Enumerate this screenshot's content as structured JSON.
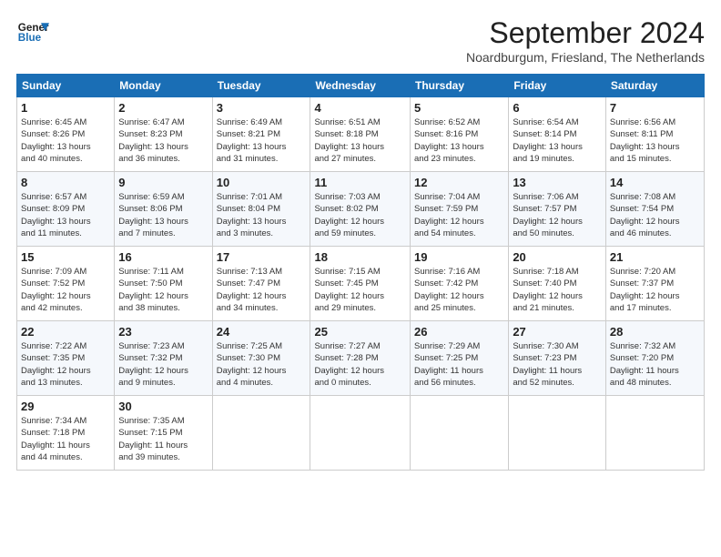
{
  "logo": {
    "line1": "General",
    "line2": "Blue"
  },
  "title": "September 2024",
  "location": "Noardburgum, Friesland, The Netherlands",
  "weekdays": [
    "Sunday",
    "Monday",
    "Tuesday",
    "Wednesday",
    "Thursday",
    "Friday",
    "Saturday"
  ],
  "weeks": [
    [
      {
        "day": "1",
        "detail": "Sunrise: 6:45 AM\nSunset: 8:26 PM\nDaylight: 13 hours\nand 40 minutes."
      },
      {
        "day": "2",
        "detail": "Sunrise: 6:47 AM\nSunset: 8:23 PM\nDaylight: 13 hours\nand 36 minutes."
      },
      {
        "day": "3",
        "detail": "Sunrise: 6:49 AM\nSunset: 8:21 PM\nDaylight: 13 hours\nand 31 minutes."
      },
      {
        "day": "4",
        "detail": "Sunrise: 6:51 AM\nSunset: 8:18 PM\nDaylight: 13 hours\nand 27 minutes."
      },
      {
        "day": "5",
        "detail": "Sunrise: 6:52 AM\nSunset: 8:16 PM\nDaylight: 13 hours\nand 23 minutes."
      },
      {
        "day": "6",
        "detail": "Sunrise: 6:54 AM\nSunset: 8:14 PM\nDaylight: 13 hours\nand 19 minutes."
      },
      {
        "day": "7",
        "detail": "Sunrise: 6:56 AM\nSunset: 8:11 PM\nDaylight: 13 hours\nand 15 minutes."
      }
    ],
    [
      {
        "day": "8",
        "detail": "Sunrise: 6:57 AM\nSunset: 8:09 PM\nDaylight: 13 hours\nand 11 minutes."
      },
      {
        "day": "9",
        "detail": "Sunrise: 6:59 AM\nSunset: 8:06 PM\nDaylight: 13 hours\nand 7 minutes."
      },
      {
        "day": "10",
        "detail": "Sunrise: 7:01 AM\nSunset: 8:04 PM\nDaylight: 13 hours\nand 3 minutes."
      },
      {
        "day": "11",
        "detail": "Sunrise: 7:03 AM\nSunset: 8:02 PM\nDaylight: 12 hours\nand 59 minutes."
      },
      {
        "day": "12",
        "detail": "Sunrise: 7:04 AM\nSunset: 7:59 PM\nDaylight: 12 hours\nand 54 minutes."
      },
      {
        "day": "13",
        "detail": "Sunrise: 7:06 AM\nSunset: 7:57 PM\nDaylight: 12 hours\nand 50 minutes."
      },
      {
        "day": "14",
        "detail": "Sunrise: 7:08 AM\nSunset: 7:54 PM\nDaylight: 12 hours\nand 46 minutes."
      }
    ],
    [
      {
        "day": "15",
        "detail": "Sunrise: 7:09 AM\nSunset: 7:52 PM\nDaylight: 12 hours\nand 42 minutes."
      },
      {
        "day": "16",
        "detail": "Sunrise: 7:11 AM\nSunset: 7:50 PM\nDaylight: 12 hours\nand 38 minutes."
      },
      {
        "day": "17",
        "detail": "Sunrise: 7:13 AM\nSunset: 7:47 PM\nDaylight: 12 hours\nand 34 minutes."
      },
      {
        "day": "18",
        "detail": "Sunrise: 7:15 AM\nSunset: 7:45 PM\nDaylight: 12 hours\nand 29 minutes."
      },
      {
        "day": "19",
        "detail": "Sunrise: 7:16 AM\nSunset: 7:42 PM\nDaylight: 12 hours\nand 25 minutes."
      },
      {
        "day": "20",
        "detail": "Sunrise: 7:18 AM\nSunset: 7:40 PM\nDaylight: 12 hours\nand 21 minutes."
      },
      {
        "day": "21",
        "detail": "Sunrise: 7:20 AM\nSunset: 7:37 PM\nDaylight: 12 hours\nand 17 minutes."
      }
    ],
    [
      {
        "day": "22",
        "detail": "Sunrise: 7:22 AM\nSunset: 7:35 PM\nDaylight: 12 hours\nand 13 minutes."
      },
      {
        "day": "23",
        "detail": "Sunrise: 7:23 AM\nSunset: 7:32 PM\nDaylight: 12 hours\nand 9 minutes."
      },
      {
        "day": "24",
        "detail": "Sunrise: 7:25 AM\nSunset: 7:30 PM\nDaylight: 12 hours\nand 4 minutes."
      },
      {
        "day": "25",
        "detail": "Sunrise: 7:27 AM\nSunset: 7:28 PM\nDaylight: 12 hours\nand 0 minutes."
      },
      {
        "day": "26",
        "detail": "Sunrise: 7:29 AM\nSunset: 7:25 PM\nDaylight: 11 hours\nand 56 minutes."
      },
      {
        "day": "27",
        "detail": "Sunrise: 7:30 AM\nSunset: 7:23 PM\nDaylight: 11 hours\nand 52 minutes."
      },
      {
        "day": "28",
        "detail": "Sunrise: 7:32 AM\nSunset: 7:20 PM\nDaylight: 11 hours\nand 48 minutes."
      }
    ],
    [
      {
        "day": "29",
        "detail": "Sunrise: 7:34 AM\nSunset: 7:18 PM\nDaylight: 11 hours\nand 44 minutes."
      },
      {
        "day": "30",
        "detail": "Sunrise: 7:35 AM\nSunset: 7:15 PM\nDaylight: 11 hours\nand 39 minutes."
      },
      null,
      null,
      null,
      null,
      null
    ]
  ]
}
